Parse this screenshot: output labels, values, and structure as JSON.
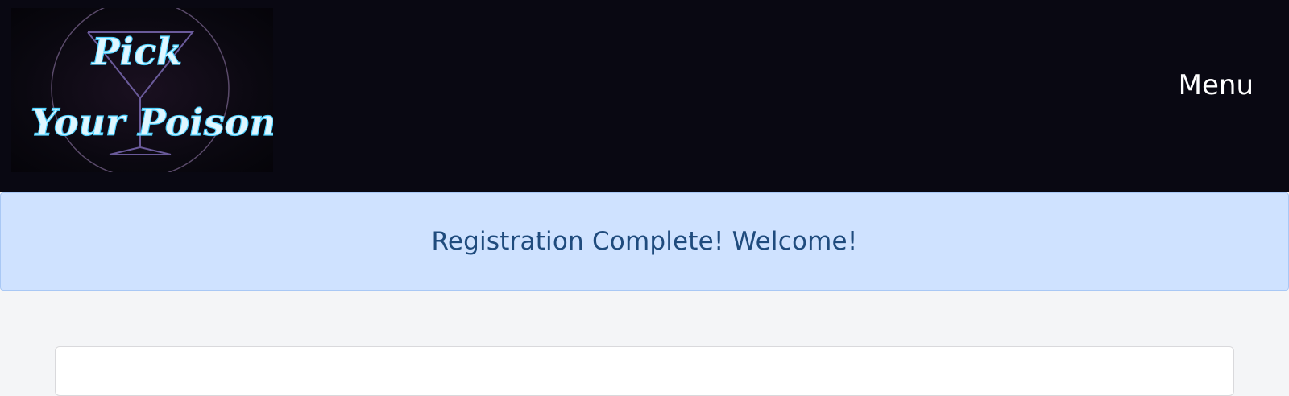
{
  "logo": {
    "line1": "Pick",
    "line2": "Your Poison",
    "icon": "cocktail-glass-icon"
  },
  "nav": {
    "menu_label": "Menu"
  },
  "alert": {
    "message": "Registration Complete! Welcome!"
  },
  "colors": {
    "navbar_bg": "#090812",
    "alert_bg": "#cfe2ff",
    "alert_text": "#1f4b7d",
    "page_bg": "#f4f5f7",
    "neon_blue": "#4fd2ff"
  }
}
